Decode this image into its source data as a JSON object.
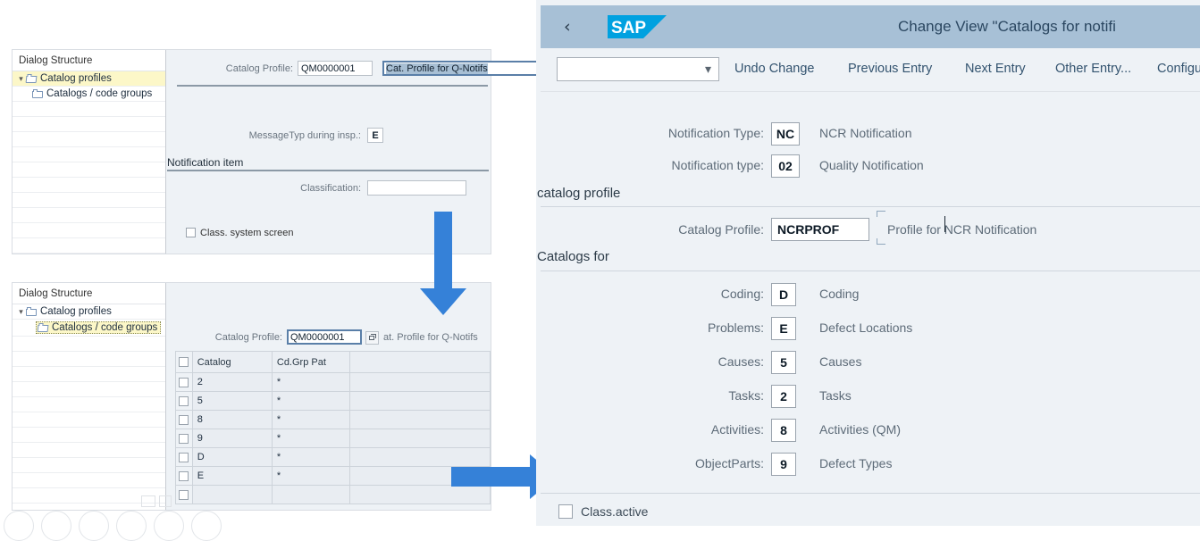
{
  "left_top_card": {
    "tree": {
      "title": "Dialog Structure",
      "items": [
        {
          "label": "Catalog profiles",
          "icon": "folder-open-icon",
          "highlighted": true,
          "indent": 0
        },
        {
          "label": "Catalogs / code groups",
          "icon": "folder-icon",
          "highlighted": false,
          "indent": 1
        }
      ]
    },
    "fields": {
      "catalog_profile_label": "Catalog Profile:",
      "catalog_profile_value": "QM0000001",
      "catalog_profile_desc": "Cat. Profile for Q-Notifs",
      "message_type_label": "MessageTyp during insp.:",
      "message_type_value": "E",
      "notification_item_section": "Notification item",
      "classification_label": "Classification:",
      "classification_value": "",
      "class_system_screen_label": "Class. system screen",
      "class_system_screen_checked": false
    }
  },
  "left_bottom_card": {
    "tree": {
      "title": "Dialog Structure",
      "items": [
        {
          "label": "Catalog profiles",
          "icon": "folder-icon",
          "highlighted": false,
          "indent": 0
        },
        {
          "label": "Catalogs / code groups",
          "icon": "folder-open-icon",
          "highlighted": true,
          "indent": 1
        }
      ]
    },
    "fields": {
      "catalog_profile_label": "Catalog Profile:",
      "catalog_profile_value": "QM0000001",
      "catalog_profile_desc": "at. Profile for Q-Notifs",
      "value_help_icon": "value-help-icon"
    },
    "table": {
      "columns": [
        "Catalog",
        "Cd.Grp Pat"
      ],
      "rows": [
        {
          "catalog": "2",
          "cd_grp_pat": "*"
        },
        {
          "catalog": "5",
          "cd_grp_pat": "*"
        },
        {
          "catalog": "8",
          "cd_grp_pat": "*"
        },
        {
          "catalog": "9",
          "cd_grp_pat": "*"
        },
        {
          "catalog": "D",
          "cd_grp_pat": "*"
        },
        {
          "catalog": "E",
          "cd_grp_pat": "*"
        },
        {
          "catalog": "",
          "cd_grp_pat": ""
        }
      ]
    }
  },
  "arrows": {
    "down_arrow_name": "down-arrow",
    "right_arrow_name": "right-arrow",
    "color": "#3581d8"
  },
  "sap_window": {
    "header": {
      "back_icon": "back-chevron-icon",
      "logo_text": "SAP",
      "logo_color": "#00a1e0",
      "title": "Change View \"Catalogs for notifi"
    },
    "toolbar": {
      "select_value": "",
      "buttons": [
        "Undo Change",
        "Previous Entry",
        "Next Entry",
        "Other Entry...",
        "Configuration"
      ]
    },
    "notification": {
      "type_label": "Notification Type:",
      "type_value": "NC",
      "type_desc": "NCR Notification",
      "subtype_label": "Notification type:",
      "subtype_value": "02",
      "subtype_desc": "Quality Notification"
    },
    "catalog_profile_section": {
      "section_title": "catalog profile",
      "label": "Catalog Profile:",
      "value": "NCRPROF",
      "desc": "Profile for NCR Notification"
    },
    "catalogs_section": {
      "section_title": "Catalogs for",
      "rows": [
        {
          "label": "Coding:",
          "value": "D",
          "desc": "Coding"
        },
        {
          "label": "Problems:",
          "value": "E",
          "desc": "Defect Locations"
        },
        {
          "label": "Causes:",
          "value": "5",
          "desc": "Causes"
        },
        {
          "label": "Tasks:",
          "value": "2",
          "desc": "Tasks"
        },
        {
          "label": "Activities:",
          "value": "8",
          "desc": "Activities (QM)"
        },
        {
          "label": "ObjectParts:",
          "value": "9",
          "desc": "Defect Types"
        }
      ]
    },
    "footer": {
      "class_active_label": "Class.active",
      "class_active_checked": false
    }
  },
  "bottom_toolbar": {
    "icons": [
      "back-circle-icon",
      "forward-circle-icon",
      "edit-circle-icon",
      "window-circle-icon",
      "refresh-circle-icon",
      "more-circle-icon"
    ]
  }
}
